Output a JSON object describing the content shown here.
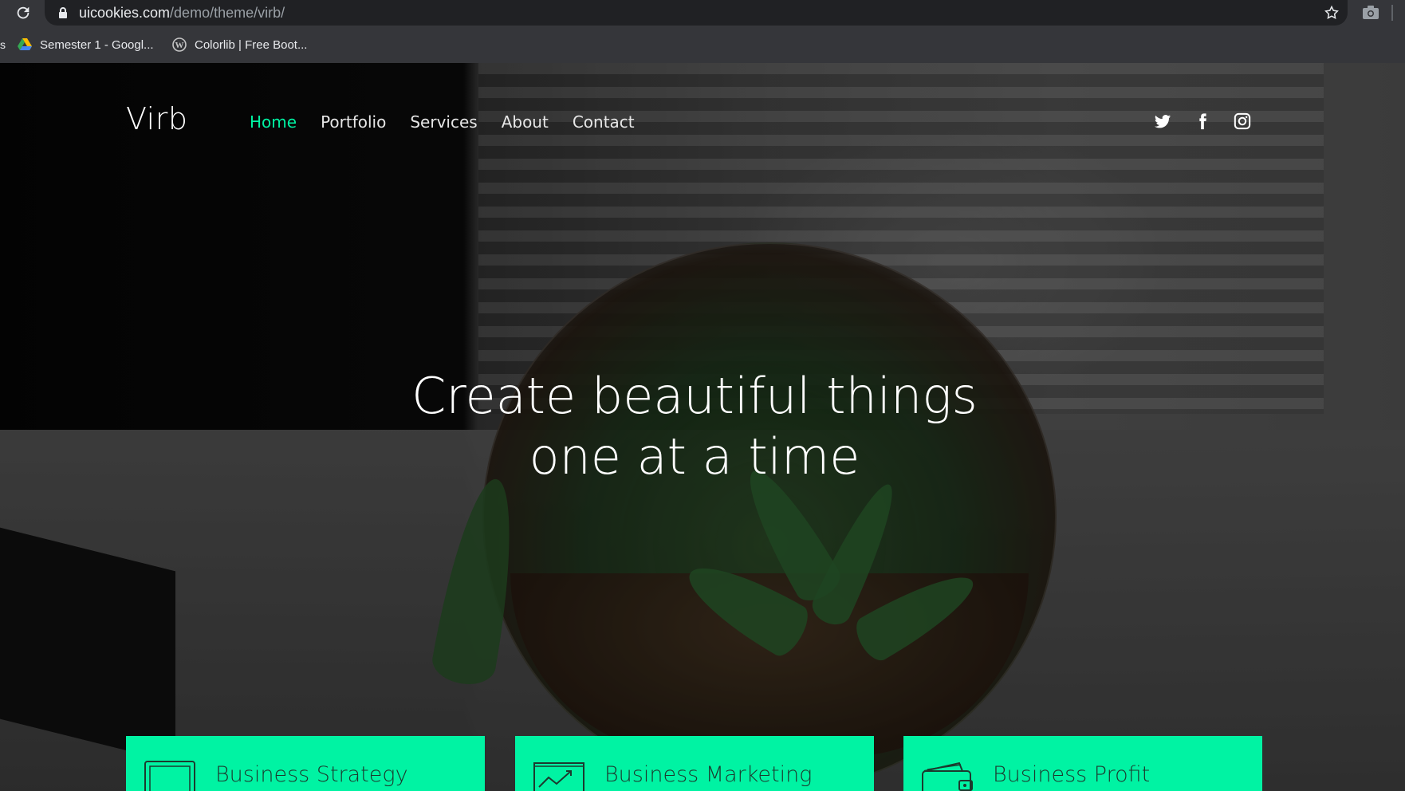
{
  "browser": {
    "url_host": "uicookies.com",
    "url_path": "/demo/theme/virb/",
    "bookmarks": [
      {
        "label": "Semester 1 - Googl...",
        "icon": "google-drive-icon"
      },
      {
        "label": "Colorlib | Free Boot...",
        "icon": "wordpress-icon"
      }
    ]
  },
  "site": {
    "logo": "Virb",
    "nav": [
      {
        "label": "Home",
        "active": true
      },
      {
        "label": "Portfolio",
        "active": false
      },
      {
        "label": "Services",
        "active": false
      },
      {
        "label": "About",
        "active": false
      },
      {
        "label": "Contact",
        "active": false
      }
    ],
    "social": [
      "twitter-icon",
      "facebook-icon",
      "instagram-icon"
    ],
    "headline_line1": "Create beautiful things",
    "headline_line2": "one at a time",
    "cards": [
      {
        "title": "Business Strategy",
        "icon": "monitor-icon"
      },
      {
        "title": "Business Marketing",
        "icon": "chart-trend-icon"
      },
      {
        "title": "Business Profit",
        "icon": "wallet-icon"
      }
    ]
  },
  "colors": {
    "accent": "#00f3a3",
    "chrome_bg": "#35363a",
    "omnibox_bg": "#202124"
  }
}
